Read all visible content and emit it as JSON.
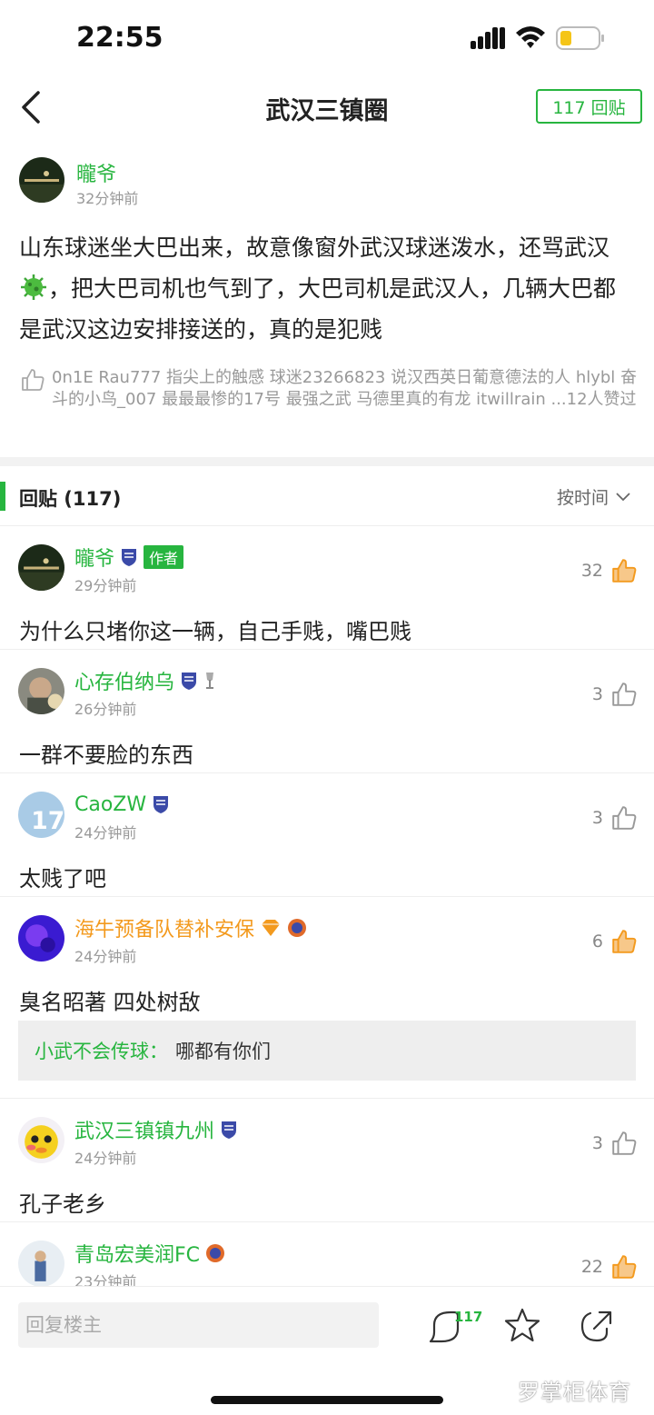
{
  "status_bar": {
    "time": "22:55"
  },
  "nav": {
    "title": "武汉三镇圈",
    "reply_button": "117 回贴"
  },
  "post": {
    "username": "曨爷",
    "time": "32分钟前",
    "body_part1": "山东球迷坐大巴出来，故意像窗外武汉球迷泼水，还骂武汉",
    "body_part2": "，把大巴司机也气到了，大巴司机是武汉人，几辆大巴都是武汉这边安排接送的，真的是犯贱",
    "likers_text": "0n1E Rau777 指尖上的触感 球迷23266823 说汉西英日葡意德法的人 hlybl 奋斗的小鸟_007 最最最惨的17号 最强之武 马德里真的有龙 itwillrain ...12人赞过"
  },
  "section": {
    "title": "回贴 (117)",
    "sort_label": "按时间"
  },
  "replies": [
    {
      "username": "曨爷",
      "author_tag": "作者",
      "time": "29分钟前",
      "likes": "32",
      "text": "为什么只堵你这一辆，自己手贱，嘴巴贱",
      "liked": true
    },
    {
      "username": "心存伯纳乌",
      "time": "26分钟前",
      "likes": "3",
      "text": "一群不要脸的东西",
      "liked": false
    },
    {
      "username": "CaoZW",
      "time": "24分钟前",
      "likes": "3",
      "text": "太贱了吧",
      "liked": false
    },
    {
      "username": "海牛预备队替补安保",
      "time": "24分钟前",
      "likes": "6",
      "text": "臭名昭著 四处树敌",
      "liked": true,
      "quote_user": "小武不会传球：",
      "quote_text": "哪都有你们"
    },
    {
      "username": "武汉三镇镇九州",
      "time": "24分钟前",
      "likes": "3",
      "text": "孔子老乡",
      "liked": false
    },
    {
      "username": "青岛宏美润FC",
      "time": "23分钟前",
      "likes": "22",
      "text": "",
      "liked": true
    }
  ],
  "bottom_bar": {
    "reply_placeholder": "回复楼主",
    "comment_count": "117"
  },
  "watermark": "罗掌柜体育",
  "colors": {
    "accent_green": "#27b53f",
    "like_orange": "#f39a1e",
    "username_orange": "#f39a1e"
  },
  "icons": [
    "back-arrow-icon",
    "thumbs-up-icon",
    "chevron-down-icon",
    "club-badge-icon",
    "comment-icon",
    "star-icon",
    "share-icon",
    "virus-emoji-icon"
  ]
}
